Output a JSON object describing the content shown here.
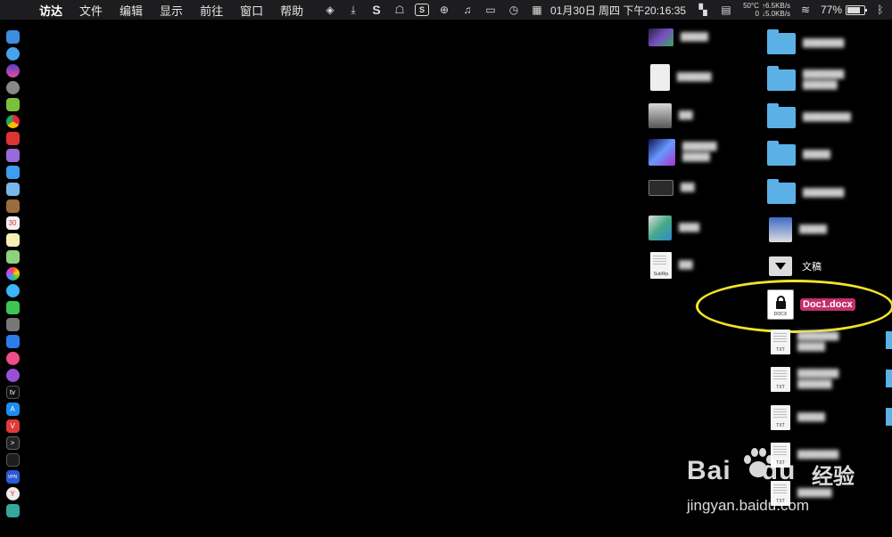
{
  "menubar": {
    "items": [
      "访达",
      "文件",
      "编辑",
      "显示",
      "前往",
      "窗口",
      "帮助"
    ],
    "clock": "01月30日 周四 下午20:16:35",
    "net_temp": "50°C",
    "net_zero": "0",
    "net_up": "↑6.5KB/s",
    "net_down": "↓5.0KB/s",
    "battery": "77%",
    "battery_level": 0.77
  },
  "desktop": {
    "folder_label": "文稿",
    "selected_file": "Doc1.docx",
    "docx_ext": "DOCX",
    "txt_ext": "TXT",
    "subrip_label": "SubRip"
  },
  "watermark": {
    "brand": "Bai",
    "brand_tail": "du",
    "cn": "经验",
    "url": "jingyan.baidu.com"
  },
  "colors": {
    "selection": "#c2306b",
    "highlight_ring": "#f2e32a",
    "folder": "#5bb1e5"
  }
}
